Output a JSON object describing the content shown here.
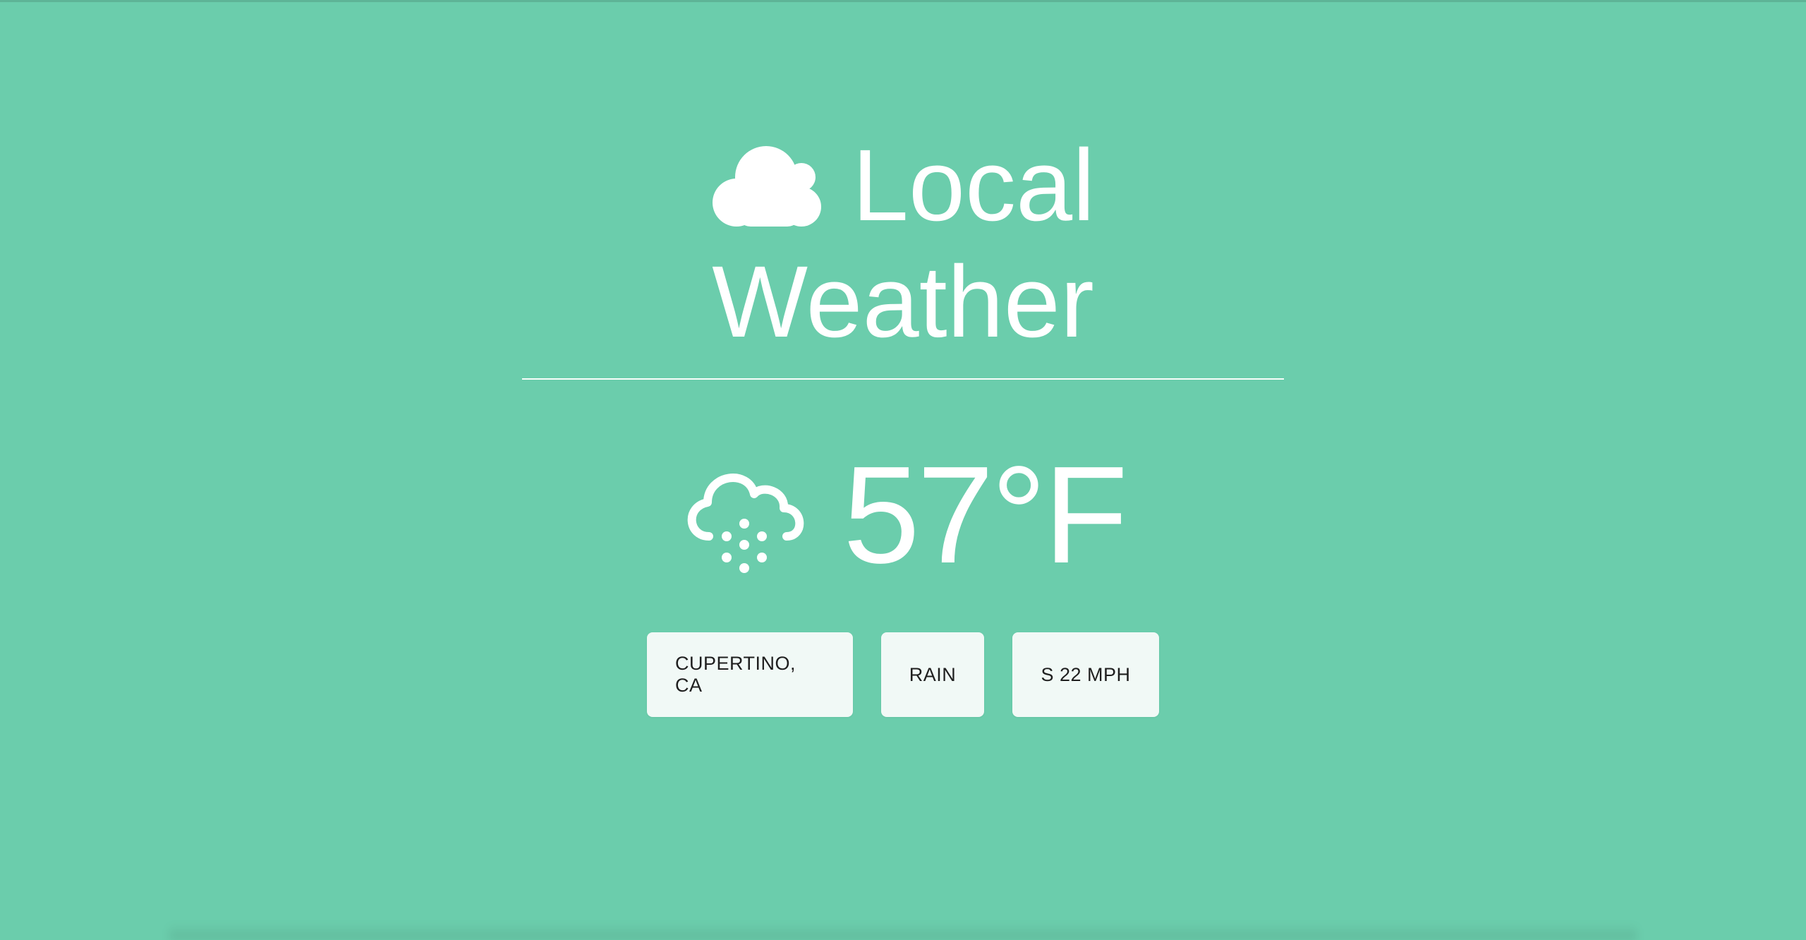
{
  "theme": {
    "background": "#6bcdac",
    "text": "#ffffff",
    "chip_background": "#f1f9f6",
    "chip_text": "#1f1f1f"
  },
  "header": {
    "title_line1": "Local",
    "title_line2": "Weather",
    "icon": "cloud-icon"
  },
  "current": {
    "icon": "rain-cloud-icon",
    "temperature": "57°F"
  },
  "info_chips": {
    "location": "CUPERTINO, CA",
    "condition": "RAIN",
    "wind": "S 22 MPH"
  }
}
